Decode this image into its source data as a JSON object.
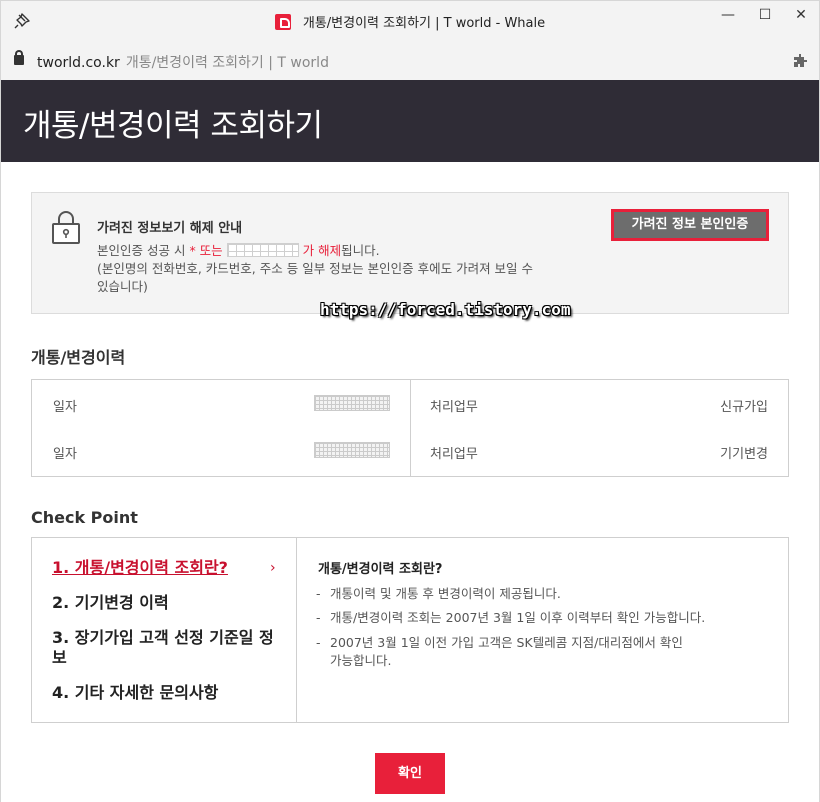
{
  "window": {
    "title": "개통/변경이력 조회하기 | T world - Whale",
    "minimize": "—",
    "maximize": "☐",
    "close": "✕"
  },
  "address": {
    "domain": "tworld.co.kr",
    "page_title": "개통/변경이력 조회하기 | T world"
  },
  "header": {
    "title": "개통/변경이력 조회하기"
  },
  "notice": {
    "title": "가려진 정보보기 해제 안내",
    "line1_prefix": "본인인증 성공 시",
    "line1_red1": "* 또는",
    "line1_red2": "가 해제",
    "line1_suffix": "됩니다.",
    "line2": "(본인명의 전화번호, 카드번호, 주소 등 일부 정보는 본인인증 후에도 가려져 보일 수",
    "line3": "있습니다)",
    "button": "가려진 정보 본인인증"
  },
  "watermark": "https://forced.tistory.com",
  "history": {
    "section_title": "개통/변경이력",
    "rows": [
      {
        "date_label": "일자",
        "task_label": "처리업무",
        "task_value": "신규가입"
      },
      {
        "date_label": "일자",
        "task_label": "처리업무",
        "task_value": "기기변경"
      }
    ]
  },
  "checkpoint": {
    "section_title": "Check Point",
    "items": [
      "1. 개통/변경이력 조회란?",
      "2. 기기변경 이력",
      "3. 장기가입 고객 선정 기준일 정보",
      "4. 기타 자세한 문의사항"
    ],
    "arrow": "›",
    "detail_title": "개통/변경이력 조회란?",
    "bullets": [
      "개통이력 및 개통 후 변경이력이 제공됩니다.",
      "개통/변경이력 조회는 2007년 3월 1일 이후 이력부터 확인 가능합니다.",
      "2007년 3월 1일 이전 가입 고객은 SK텔레콤 지점/대리점에서 확인",
      "가능합니다."
    ],
    "dash": "-"
  },
  "confirm_button": "확인",
  "colors": {
    "brand_red": "#e8203a",
    "header_bg": "#2f2c36",
    "button_gray": "#6d6d6d"
  }
}
